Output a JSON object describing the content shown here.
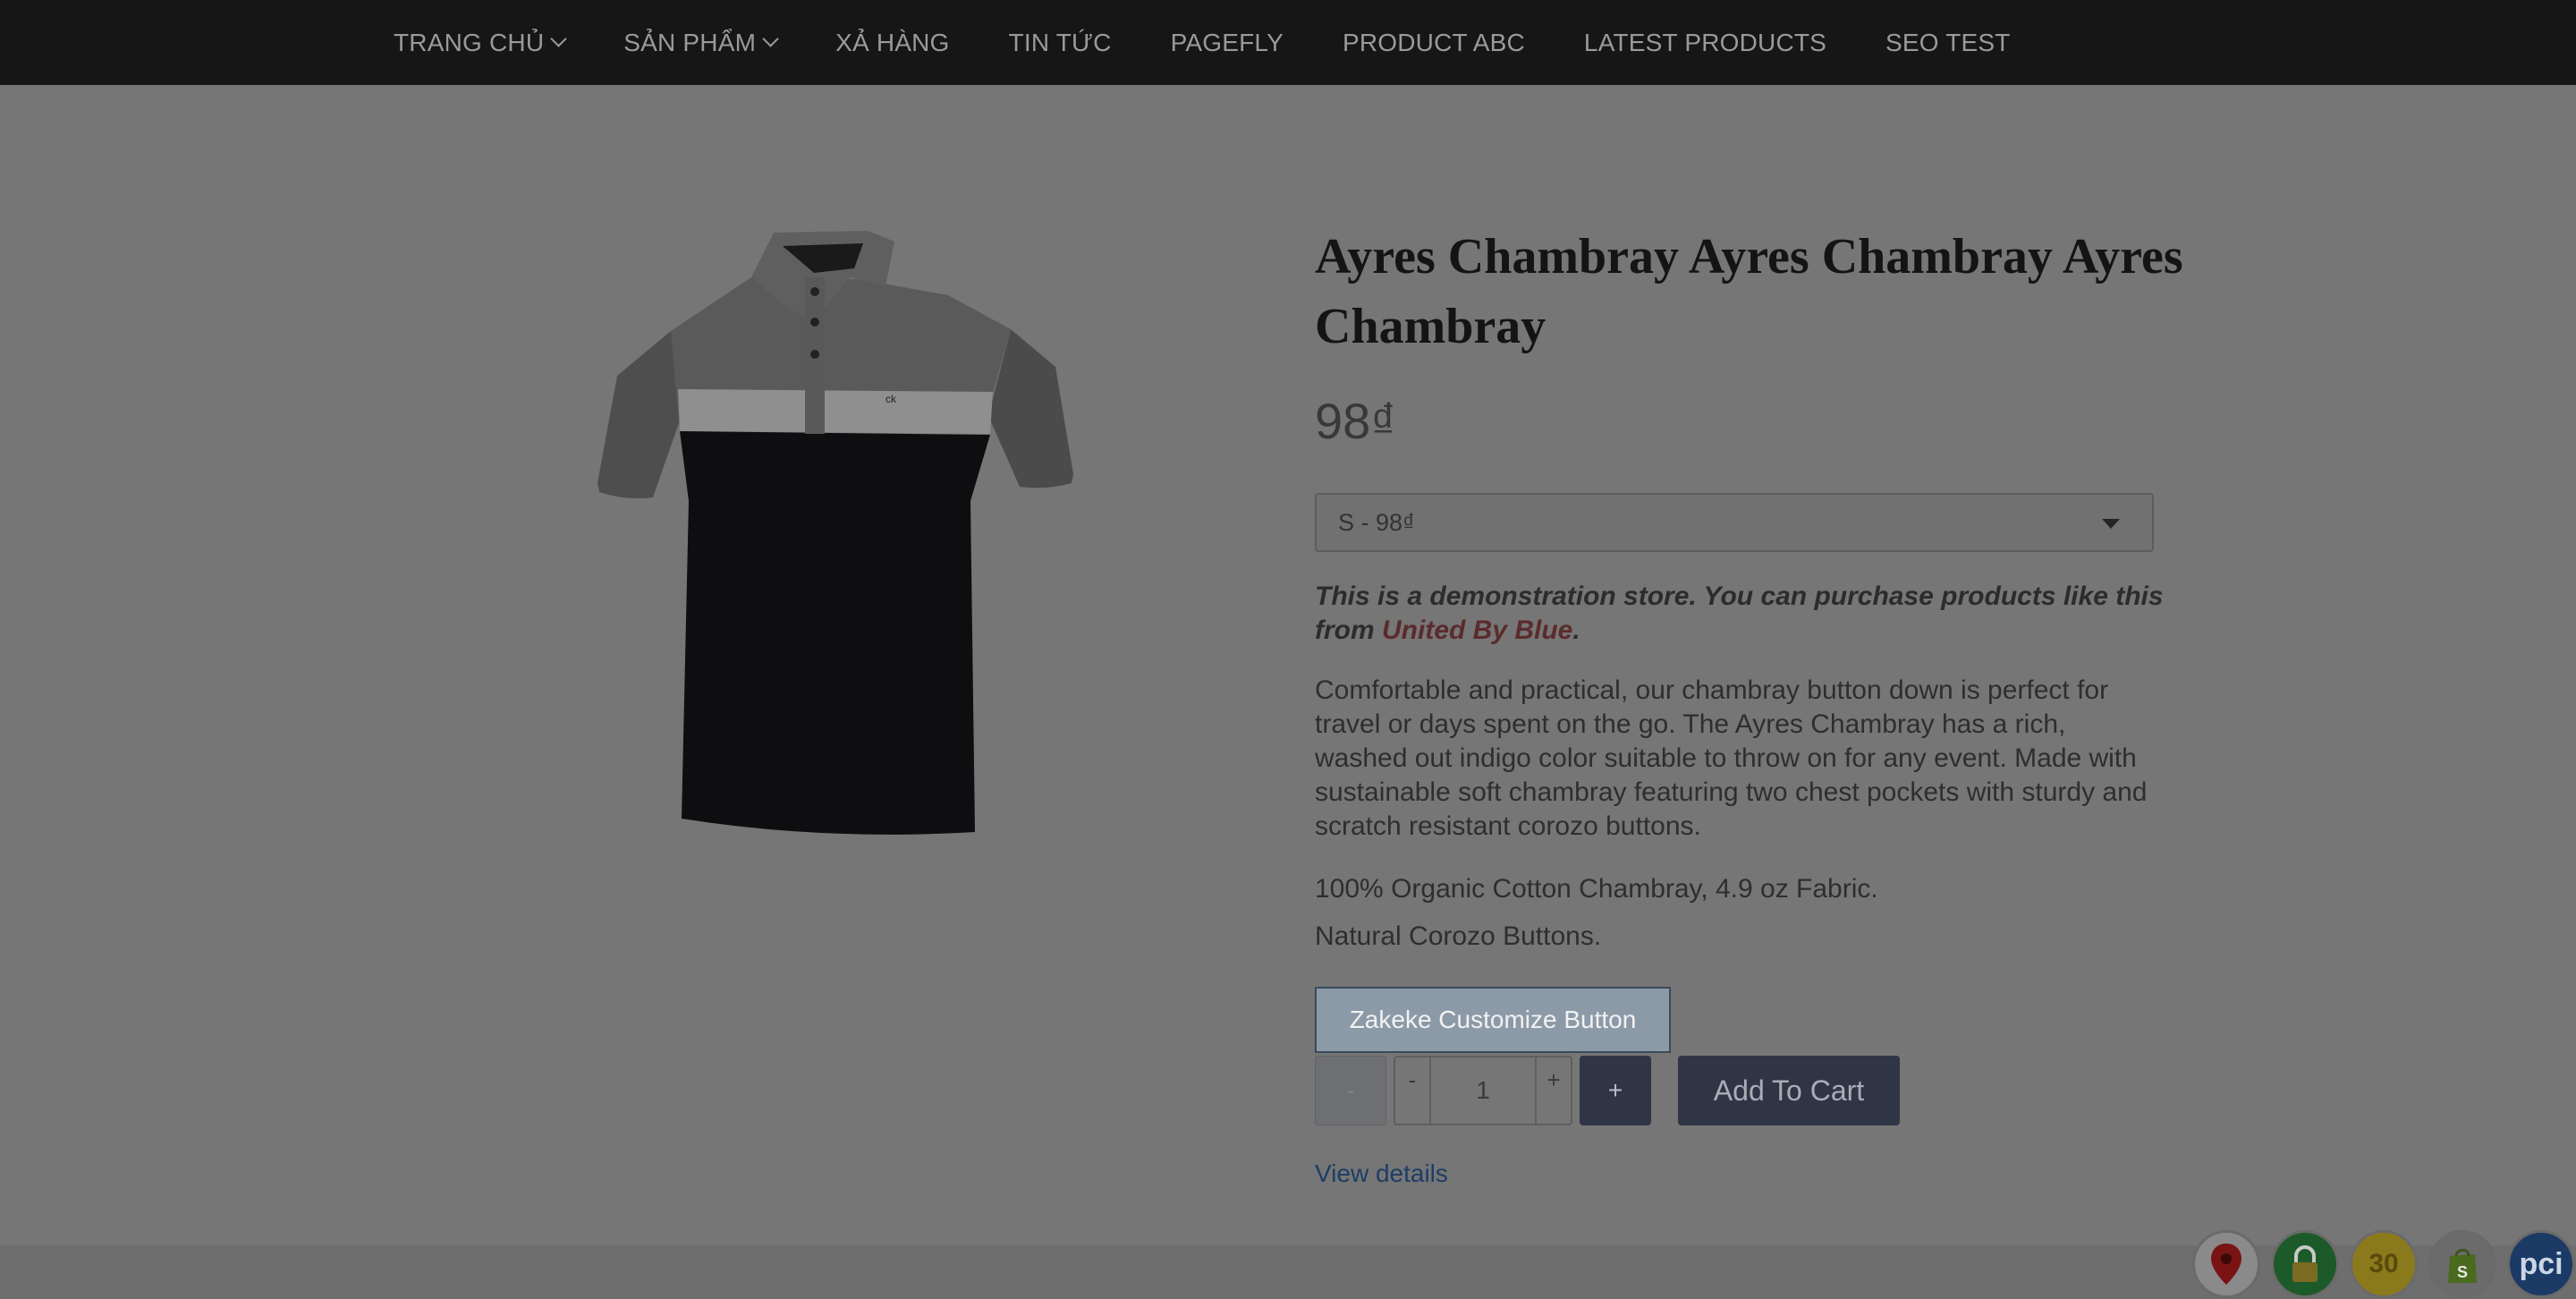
{
  "nav": {
    "items": [
      {
        "label": "TRANG CHỦ",
        "dropdown": true
      },
      {
        "label": "SẢN PHẨM",
        "dropdown": true
      },
      {
        "label": "XẢ HÀNG"
      },
      {
        "label": "TIN TỨC"
      },
      {
        "label": "PAGEFLY"
      },
      {
        "label": "PRODUCT ABC"
      },
      {
        "label": "LATEST PRODUCTS"
      },
      {
        "label": "SEO TEST"
      }
    ]
  },
  "product": {
    "title": "Ayres Chambray Ayres Chambray Ayres Chambray",
    "price": "98₫",
    "variant_selected": "S - 98₫",
    "demo_text": "This is a demonstration store. You can purchase products like this from ",
    "demo_link": "United By Blue",
    "demo_end": ".",
    "description": "Comfortable and practical, our chambray button down is perfect for travel or days spent on the go. The Ayres Chambray has a rich, washed out indigo color suitable to throw on for any event. Made with sustainable soft chambray featuring two chest pockets with sturdy and scratch resistant corozo buttons.",
    "spec1": "100% Organic Cotton Chambray, 4.9 oz Fabric.",
    "spec2": "Natural Corozo Buttons.",
    "logo_text": "ck"
  },
  "actions": {
    "zakeke_label": "Zakeke Customize Button",
    "qty_minus_big": "-",
    "qty_minus_small": "-",
    "qty_value": "1",
    "qty_plus_small": "+",
    "qty_plus_big": "+",
    "add_to_cart": "Add To Cart",
    "view_details": "View details"
  },
  "trust_badges": {
    "days_badge": "30",
    "pci_badge": "pci",
    "icons": [
      "map-pin-icon",
      "lock-icon",
      "30-days-badge",
      "shopify-bag-icon",
      "pci-badge"
    ]
  },
  "colors": {
    "nav_bg": "#161616",
    "overlay_bg": "#767676",
    "button_dark": "#2f3545",
    "link": "#1d3d66"
  }
}
